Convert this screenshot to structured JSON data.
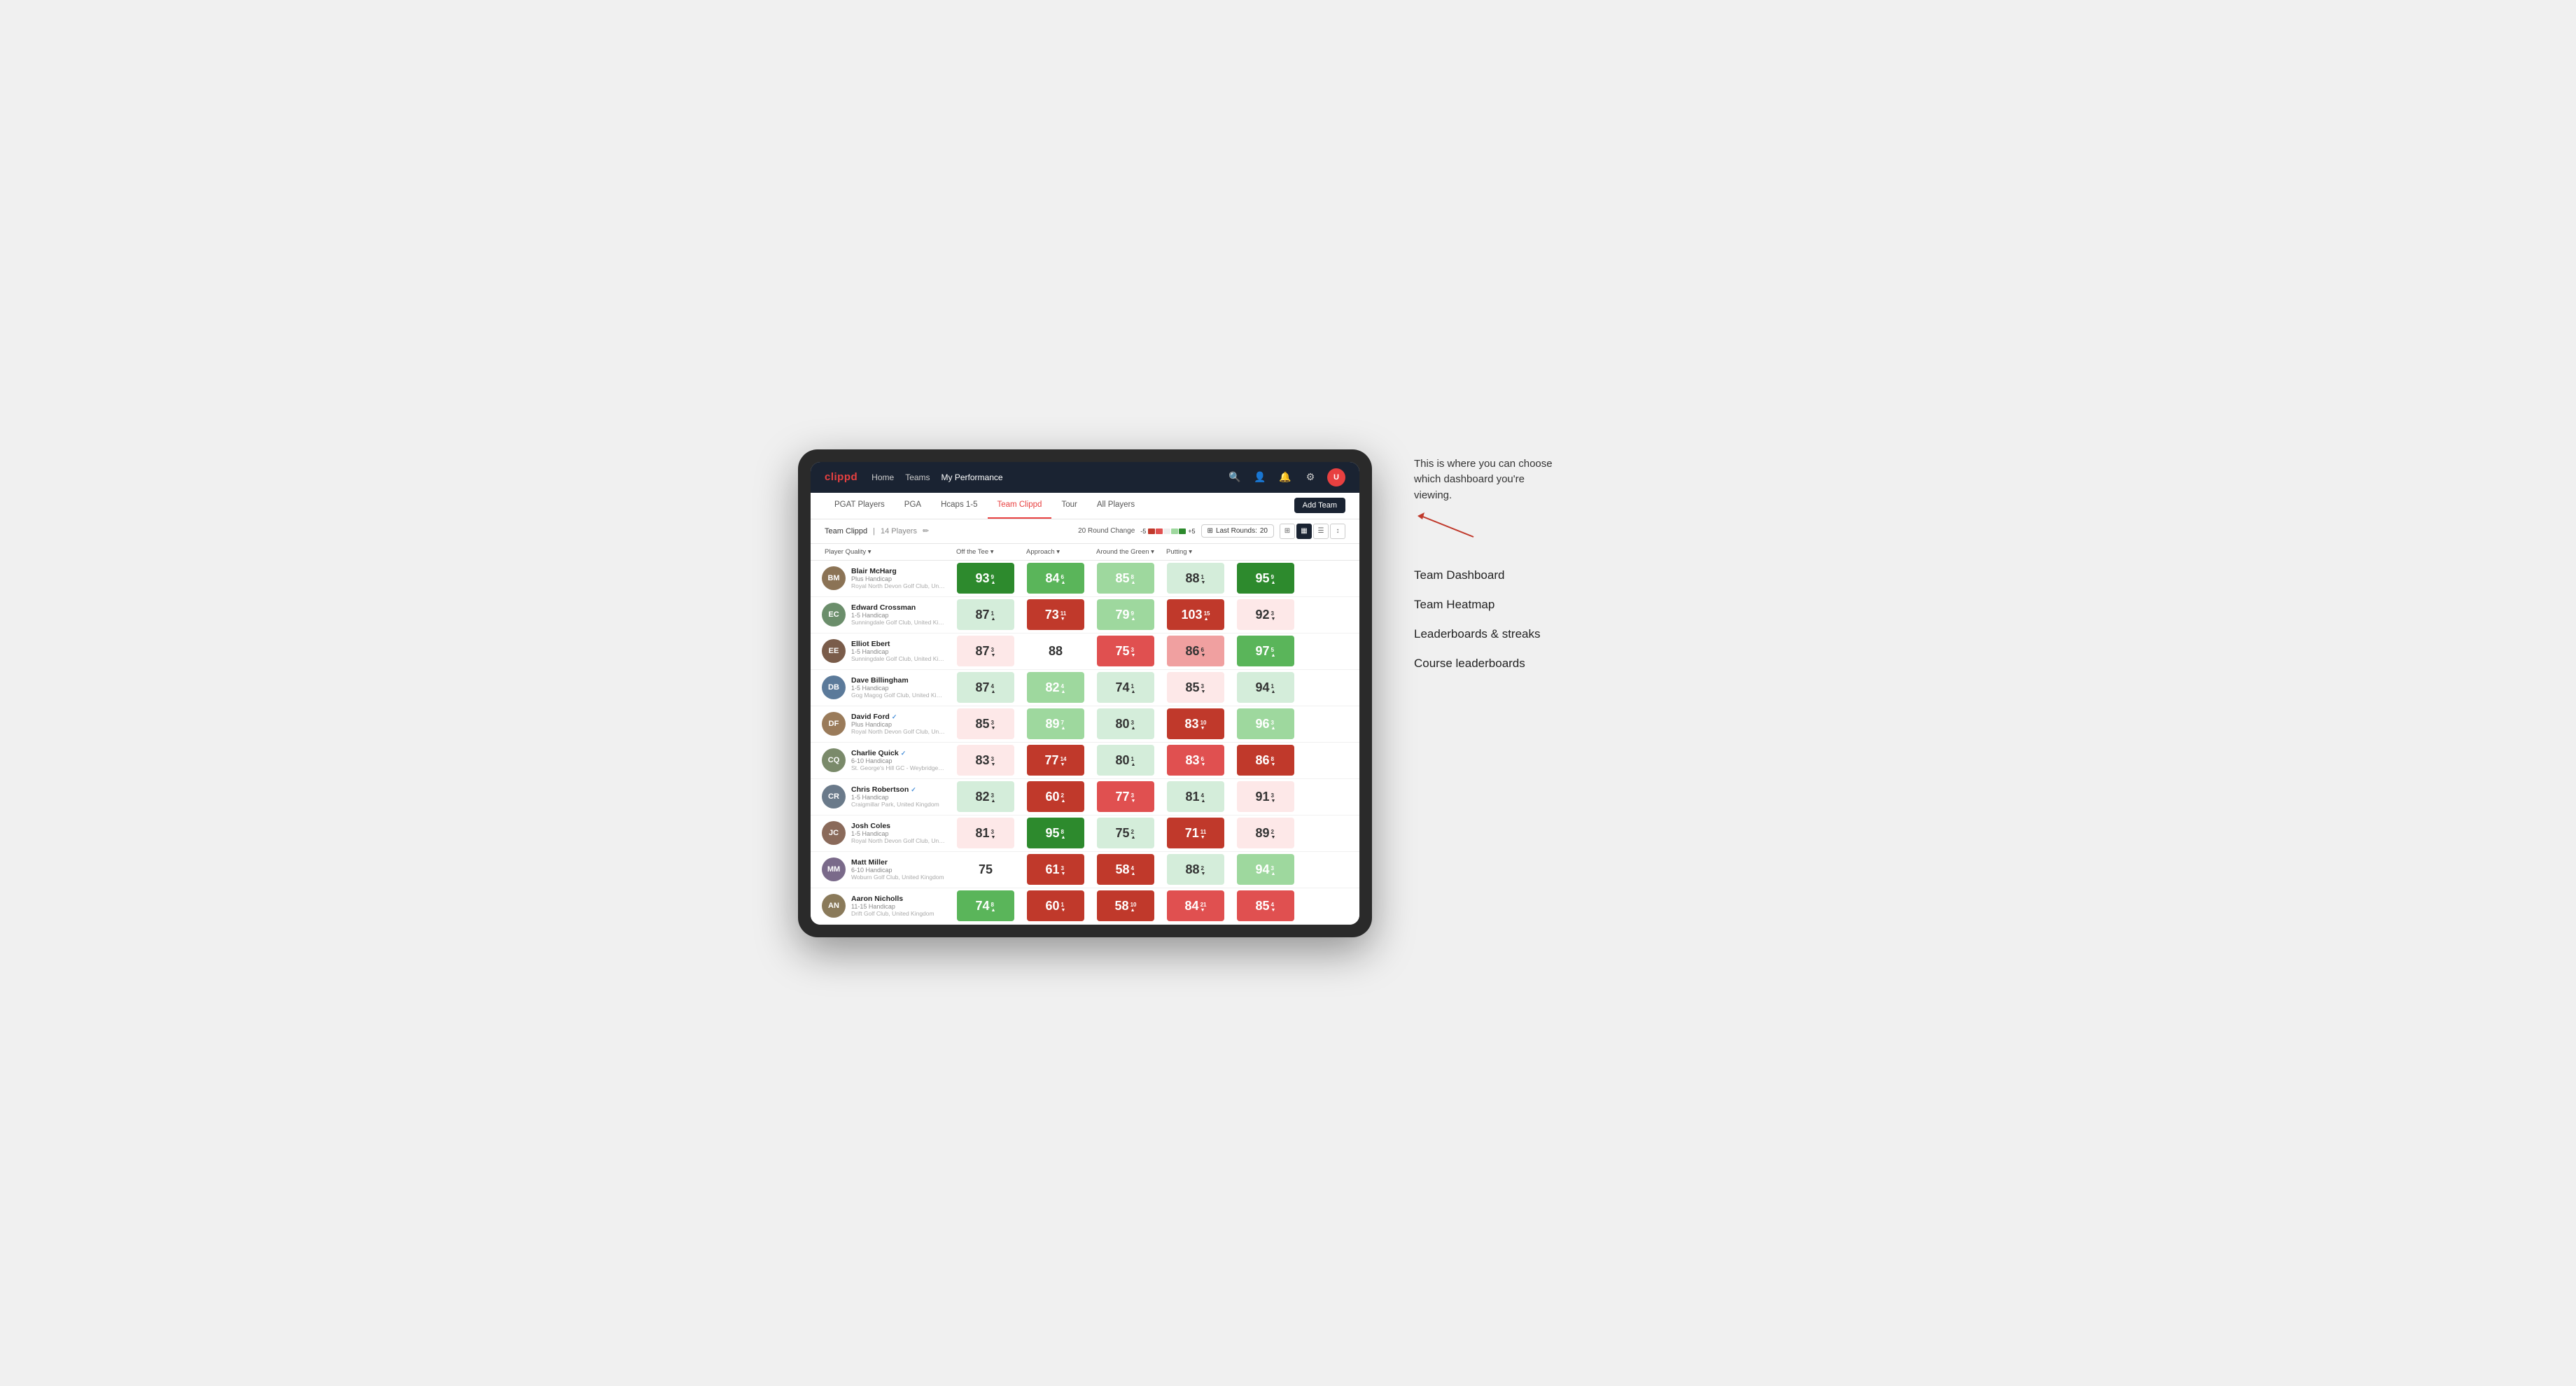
{
  "annotation": {
    "intro_text": "This is where you can choose which dashboard you're viewing.",
    "options": [
      "Team Dashboard",
      "Team Heatmap",
      "Leaderboards & streaks",
      "Course leaderboards"
    ]
  },
  "nav": {
    "logo": "clippd",
    "links": [
      "Home",
      "Teams",
      "My Performance"
    ],
    "active_link": "My Performance"
  },
  "sub_nav": {
    "links": [
      "PGAT Players",
      "PGA",
      "Hcaps 1-5",
      "Team Clippd",
      "Tour",
      "All Players"
    ],
    "active_link": "Team Clippd",
    "add_team_label": "Add Team"
  },
  "team_header": {
    "title": "Team Clippd",
    "separator": "|",
    "count": "14 Players",
    "round_change_label": "20 Round Change",
    "scale_neg": "-5",
    "scale_pos": "+5",
    "last_rounds_label": "Last Rounds:",
    "last_rounds_value": "20"
  },
  "table": {
    "columns": [
      "Player Quality ▾",
      "Off the Tee ▾",
      "Approach ▾",
      "Around the Green ▾",
      "Putting ▾"
    ],
    "rows": [
      {
        "name": "Blair McHarg",
        "handicap": "Plus Handicap",
        "club": "Royal North Devon Golf Club, United Kingdom",
        "initials": "BM",
        "avatar_bg": "#8B7355",
        "stats": [
          {
            "value": "93",
            "change": "9",
            "dir": "up",
            "bg": "bg-green-strong"
          },
          {
            "value": "84",
            "change": "6",
            "dir": "up",
            "bg": "bg-green-med"
          },
          {
            "value": "85",
            "change": "8",
            "dir": "up",
            "bg": "bg-green-light"
          },
          {
            "value": "88",
            "change": "1",
            "dir": "down",
            "bg": "bg-green-pale"
          },
          {
            "value": "95",
            "change": "9",
            "dir": "up",
            "bg": "bg-green-strong"
          }
        ]
      },
      {
        "name": "Edward Crossman",
        "handicap": "1-5 Handicap",
        "club": "Sunningdale Golf Club, United Kingdom",
        "initials": "EC",
        "avatar_bg": "#6B8E6B",
        "stats": [
          {
            "value": "87",
            "change": "1",
            "dir": "up",
            "bg": "bg-green-pale"
          },
          {
            "value": "73",
            "change": "11",
            "dir": "down",
            "bg": "bg-red-strong"
          },
          {
            "value": "79",
            "change": "9",
            "dir": "up",
            "bg": "bg-green-light"
          },
          {
            "value": "103",
            "change": "15",
            "dir": "up",
            "bg": "bg-red-strong"
          },
          {
            "value": "92",
            "change": "3",
            "dir": "down",
            "bg": "bg-red-pale"
          }
        ]
      },
      {
        "name": "Elliot Ebert",
        "handicap": "1-5 Handicap",
        "club": "Sunningdale Golf Club, United Kingdom",
        "initials": "EE",
        "avatar_bg": "#7A5C4A",
        "stats": [
          {
            "value": "87",
            "change": "3",
            "dir": "down",
            "bg": "bg-red-pale"
          },
          {
            "value": "88",
            "change": "",
            "dir": "neutral",
            "bg": "bg-white"
          },
          {
            "value": "75",
            "change": "3",
            "dir": "down",
            "bg": "bg-red-med"
          },
          {
            "value": "86",
            "change": "6",
            "dir": "down",
            "bg": "bg-red-light"
          },
          {
            "value": "97",
            "change": "5",
            "dir": "up",
            "bg": "bg-green-med"
          }
        ]
      },
      {
        "name": "Dave Billingham",
        "handicap": "1-5 Handicap",
        "club": "Gog Magog Golf Club, United Kingdom",
        "initials": "DB",
        "avatar_bg": "#5B7A9A",
        "stats": [
          {
            "value": "87",
            "change": "4",
            "dir": "up",
            "bg": "bg-green-pale"
          },
          {
            "value": "82",
            "change": "4",
            "dir": "up",
            "bg": "bg-green-light"
          },
          {
            "value": "74",
            "change": "1",
            "dir": "up",
            "bg": "bg-green-pale"
          },
          {
            "value": "85",
            "change": "3",
            "dir": "down",
            "bg": "bg-red-pale"
          },
          {
            "value": "94",
            "change": "1",
            "dir": "up",
            "bg": "bg-green-pale"
          }
        ]
      },
      {
        "name": "David Ford",
        "handicap": "Plus Handicap",
        "club": "Royal North Devon Golf Club, United Kingdom",
        "initials": "DF",
        "verified": true,
        "avatar_bg": "#9A7B5A",
        "stats": [
          {
            "value": "85",
            "change": "3",
            "dir": "down",
            "bg": "bg-red-pale"
          },
          {
            "value": "89",
            "change": "7",
            "dir": "up",
            "bg": "bg-green-light"
          },
          {
            "value": "80",
            "change": "3",
            "dir": "up",
            "bg": "bg-green-pale"
          },
          {
            "value": "83",
            "change": "10",
            "dir": "down",
            "bg": "bg-red-strong"
          },
          {
            "value": "96",
            "change": "3",
            "dir": "up",
            "bg": "bg-green-light"
          }
        ]
      },
      {
        "name": "Charlie Quick",
        "handicap": "6-10 Handicap",
        "club": "St. George's Hill GC - Weybridge - Surrey, Uni...",
        "initials": "CQ",
        "verified": true,
        "avatar_bg": "#7A8A6A",
        "stats": [
          {
            "value": "83",
            "change": "3",
            "dir": "down",
            "bg": "bg-red-pale"
          },
          {
            "value": "77",
            "change": "14",
            "dir": "down",
            "bg": "bg-red-strong"
          },
          {
            "value": "80",
            "change": "1",
            "dir": "up",
            "bg": "bg-green-pale"
          },
          {
            "value": "83",
            "change": "6",
            "dir": "down",
            "bg": "bg-red-med"
          },
          {
            "value": "86",
            "change": "8",
            "dir": "down",
            "bg": "bg-red-strong"
          }
        ]
      },
      {
        "name": "Chris Robertson",
        "handicap": "1-5 Handicap",
        "club": "Craigmillar Park, United Kingdom",
        "initials": "CR",
        "verified": true,
        "avatar_bg": "#6A7A8A",
        "stats": [
          {
            "value": "82",
            "change": "3",
            "dir": "up",
            "bg": "bg-green-pale"
          },
          {
            "value": "60",
            "change": "2",
            "dir": "up",
            "bg": "bg-red-strong"
          },
          {
            "value": "77",
            "change": "3",
            "dir": "down",
            "bg": "bg-red-med"
          },
          {
            "value": "81",
            "change": "4",
            "dir": "up",
            "bg": "bg-green-pale"
          },
          {
            "value": "91",
            "change": "3",
            "dir": "down",
            "bg": "bg-red-pale"
          }
        ]
      },
      {
        "name": "Josh Coles",
        "handicap": "1-5 Handicap",
        "club": "Royal North Devon Golf Club, United Kingdom",
        "initials": "JC",
        "avatar_bg": "#8A6A5A",
        "stats": [
          {
            "value": "81",
            "change": "3",
            "dir": "down",
            "bg": "bg-red-pale"
          },
          {
            "value": "95",
            "change": "8",
            "dir": "up",
            "bg": "bg-green-strong"
          },
          {
            "value": "75",
            "change": "2",
            "dir": "up",
            "bg": "bg-green-pale"
          },
          {
            "value": "71",
            "change": "11",
            "dir": "down",
            "bg": "bg-red-strong"
          },
          {
            "value": "89",
            "change": "2",
            "dir": "down",
            "bg": "bg-red-pale"
          }
        ]
      },
      {
        "name": "Matt Miller",
        "handicap": "6-10 Handicap",
        "club": "Woburn Golf Club, United Kingdom",
        "initials": "MM",
        "avatar_bg": "#7A6A8A",
        "stats": [
          {
            "value": "75",
            "change": "",
            "dir": "neutral",
            "bg": "bg-white"
          },
          {
            "value": "61",
            "change": "3",
            "dir": "down",
            "bg": "bg-red-strong"
          },
          {
            "value": "58",
            "change": "4",
            "dir": "up",
            "bg": "bg-red-strong"
          },
          {
            "value": "88",
            "change": "2",
            "dir": "down",
            "bg": "bg-green-pale"
          },
          {
            "value": "94",
            "change": "3",
            "dir": "up",
            "bg": "bg-green-light"
          }
        ]
      },
      {
        "name": "Aaron Nicholls",
        "handicap": "11-15 Handicap",
        "club": "Drift Golf Club, United Kingdom",
        "initials": "AN",
        "avatar_bg": "#8A7A5A",
        "stats": [
          {
            "value": "74",
            "change": "8",
            "dir": "up",
            "bg": "bg-green-med"
          },
          {
            "value": "60",
            "change": "1",
            "dir": "down",
            "bg": "bg-red-strong"
          },
          {
            "value": "58",
            "change": "10",
            "dir": "up",
            "bg": "bg-red-strong"
          },
          {
            "value": "84",
            "change": "21",
            "dir": "down",
            "bg": "bg-red-med"
          },
          {
            "value": "85",
            "change": "4",
            "dir": "down",
            "bg": "bg-red-med"
          }
        ]
      }
    ]
  }
}
